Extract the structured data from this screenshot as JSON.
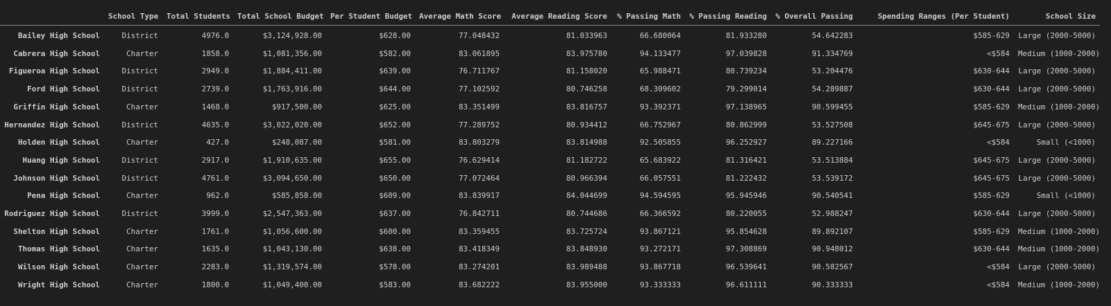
{
  "table": {
    "columns": [
      "",
      "School Type",
      "Total Students",
      "Total School Budget",
      "Per Student Budget",
      "Average Math Score",
      "Average Reading Score",
      "% Passing Math",
      "% Passing Reading",
      "% Overall Passing",
      "Spending Ranges (Per Student)",
      "School Size"
    ],
    "rows": [
      [
        "Bailey High School",
        "District",
        "4976.0",
        "$3,124,928.00",
        "$628.00",
        "77.048432",
        "81.033963",
        "66.680064",
        "81.933280",
        "54.642283",
        "$585-629",
        "Large (2000-5000)"
      ],
      [
        "Cabrera High School",
        "Charter",
        "1858.0",
        "$1,081,356.00",
        "$582.00",
        "83.061895",
        "83.975780",
        "94.133477",
        "97.039828",
        "91.334769",
        "<$584",
        "Medium (1000-2000)"
      ],
      [
        "Figueroa High School",
        "District",
        "2949.0",
        "$1,884,411.00",
        "$639.00",
        "76.711767",
        "81.158020",
        "65.988471",
        "80.739234",
        "53.204476",
        "$630-644",
        "Large (2000-5000)"
      ],
      [
        "Ford High School",
        "District",
        "2739.0",
        "$1,763,916.00",
        "$644.00",
        "77.102592",
        "80.746258",
        "68.309602",
        "79.299014",
        "54.289887",
        "$630-644",
        "Large (2000-5000)"
      ],
      [
        "Griffin High School",
        "Charter",
        "1468.0",
        "$917,500.00",
        "$625.00",
        "83.351499",
        "83.816757",
        "93.392371",
        "97.138965",
        "90.599455",
        "$585-629",
        "Medium (1000-2000)"
      ],
      [
        "Hernandez High School",
        "District",
        "4635.0",
        "$3,022,020.00",
        "$652.00",
        "77.289752",
        "80.934412",
        "66.752967",
        "80.862999",
        "53.527508",
        "$645-675",
        "Large (2000-5000)"
      ],
      [
        "Holden High School",
        "Charter",
        "427.0",
        "$248,087.00",
        "$581.00",
        "83.803279",
        "83.814988",
        "92.505855",
        "96.252927",
        "89.227166",
        "<$584",
        "Small (<1000)"
      ],
      [
        "Huang High School",
        "District",
        "2917.0",
        "$1,910,635.00",
        "$655.00",
        "76.629414",
        "81.182722",
        "65.683922",
        "81.316421",
        "53.513884",
        "$645-675",
        "Large (2000-5000)"
      ],
      [
        "Johnson High School",
        "District",
        "4761.0",
        "$3,094,650.00",
        "$650.00",
        "77.072464",
        "80.966394",
        "66.057551",
        "81.222432",
        "53.539172",
        "$645-675",
        "Large (2000-5000)"
      ],
      [
        "Pena High School",
        "Charter",
        "962.0",
        "$585,858.00",
        "$609.00",
        "83.839917",
        "84.044699",
        "94.594595",
        "95.945946",
        "90.540541",
        "$585-629",
        "Small (<1000)"
      ],
      [
        "Rodriguez High School",
        "District",
        "3999.0",
        "$2,547,363.00",
        "$637.00",
        "76.842711",
        "80.744686",
        "66.366592",
        "80.220055",
        "52.988247",
        "$630-644",
        "Large (2000-5000)"
      ],
      [
        "Shelton High School",
        "Charter",
        "1761.0",
        "$1,056,600.00",
        "$600.00",
        "83.359455",
        "83.725724",
        "93.867121",
        "95.854628",
        "89.892107",
        "$585-629",
        "Medium (1000-2000)"
      ],
      [
        "Thomas High School",
        "Charter",
        "1635.0",
        "$1,043,130.00",
        "$638.00",
        "83.418349",
        "83.848930",
        "93.272171",
        "97.308869",
        "90.948012",
        "$630-644",
        "Medium (1000-2000)"
      ],
      [
        "Wilson High School",
        "Charter",
        "2283.0",
        "$1,319,574.00",
        "$578.00",
        "83.274201",
        "83.989488",
        "93.867718",
        "96.539641",
        "90.582567",
        "<$584",
        "Large (2000-5000)"
      ],
      [
        "Wright High School",
        "Charter",
        "1800.0",
        "$1,049,400.00",
        "$583.00",
        "83.682222",
        "83.955000",
        "93.333333",
        "96.611111",
        "90.333333",
        "<$584",
        "Medium (1000-2000)"
      ]
    ]
  },
  "colors": {
    "background": "#1f1f1f",
    "text": "#cccccc",
    "header_rule": "#888888"
  }
}
